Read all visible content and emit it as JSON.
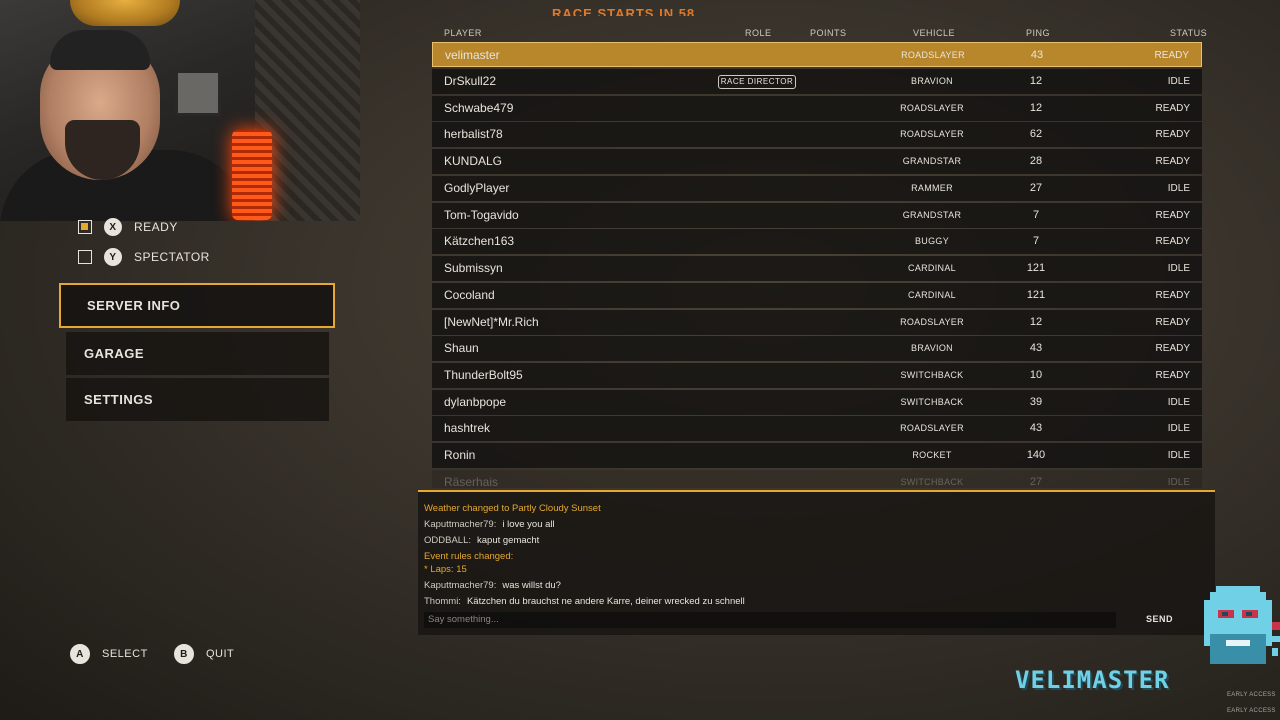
{
  "countdown": "RACE STARTS IN 58",
  "lobby": {
    "checkboxes": [
      {
        "glyph": "X",
        "label": "READY",
        "checked": true
      },
      {
        "glyph": "Y",
        "label": "SPECTATOR",
        "checked": false
      }
    ],
    "menu": [
      {
        "label": "SERVER INFO",
        "active": true
      },
      {
        "label": "GARAGE",
        "active": false
      },
      {
        "label": "SETTINGS",
        "active": false
      }
    ],
    "hints": [
      {
        "glyph": "A",
        "label": "SELECT"
      },
      {
        "glyph": "B",
        "label": "QUIT"
      }
    ]
  },
  "table": {
    "headers": {
      "player": "PLAYER",
      "role": "ROLE",
      "points": "POINTS",
      "vehicle": "VEHICLE",
      "ping": "PING",
      "status": "STATUS"
    },
    "rows": [
      {
        "player": "velimaster",
        "role": "",
        "vehicle": "ROADSLAYER",
        "ping": "43",
        "status": "READY"
      },
      {
        "player": "DrSkull22",
        "role": "RACE DIRECTOR",
        "vehicle": "BRAVION",
        "ping": "12",
        "status": "IDLE"
      },
      {
        "player": "Schwabe479",
        "role": "",
        "vehicle": "ROADSLAYER",
        "ping": "12",
        "status": "READY"
      },
      {
        "player": "herbalist78",
        "role": "",
        "vehicle": "ROADSLAYER",
        "ping": "62",
        "status": "READY"
      },
      {
        "player": "KUNDALG",
        "role": "",
        "vehicle": "GRANDSTAR",
        "ping": "28",
        "status": "READY"
      },
      {
        "player": "GodlyPlayer",
        "role": "",
        "vehicle": "RAMMER",
        "ping": "27",
        "status": "IDLE"
      },
      {
        "player": "Tom-Togavido",
        "role": "",
        "vehicle": "GRANDSTAR",
        "ping": "7",
        "status": "READY"
      },
      {
        "player": "Kätzchen163",
        "role": "",
        "vehicle": "BUGGY",
        "ping": "7",
        "status": "READY"
      },
      {
        "player": "Submissyn",
        "role": "",
        "vehicle": "CARDINAL",
        "ping": "121",
        "status": "IDLE"
      },
      {
        "player": "Cocoland",
        "role": "",
        "vehicle": "CARDINAL",
        "ping": "121",
        "status": "READY"
      },
      {
        "player": "[NewNet]*Mr.Rich",
        "role": "",
        "vehicle": "ROADSLAYER",
        "ping": "12",
        "status": "READY"
      },
      {
        "player": "Shaun",
        "role": "",
        "vehicle": "BRAVION",
        "ping": "43",
        "status": "READY"
      },
      {
        "player": "ThunderBolt95",
        "role": "",
        "vehicle": "SWITCHBACK",
        "ping": "10",
        "status": "READY"
      },
      {
        "player": "dylanbpope",
        "role": "",
        "vehicle": "SWITCHBACK",
        "ping": "39",
        "status": "IDLE"
      },
      {
        "player": "hashtrek",
        "role": "",
        "vehicle": "ROADSLAYER",
        "ping": "43",
        "status": "IDLE"
      },
      {
        "player": "Ronin",
        "role": "",
        "vehicle": "ROCKET",
        "ping": "140",
        "status": "IDLE"
      },
      {
        "player": "Räserhais",
        "role": "",
        "vehicle": "SWITCHBACK",
        "ping": "27",
        "status": "IDLE"
      }
    ]
  },
  "chat": {
    "lines": [
      {
        "type": "system",
        "text": "Weather changed to Partly Cloudy Sunset"
      },
      {
        "type": "msg",
        "name": "Kaputtmacher79:",
        "text": "i love you all"
      },
      {
        "type": "msg",
        "name": "ODDBALL:",
        "text": "kaput gemacht"
      },
      {
        "type": "system",
        "text": " Event rules changed:"
      },
      {
        "type": "system",
        "text": "* Laps: 15"
      },
      {
        "type": "msg",
        "name": "Kaputtmacher79:",
        "text": "was willst du?"
      },
      {
        "type": "msg",
        "name": "Thommi:",
        "text": "Kätzchen du brauchst ne andere Karre, deiner wrecked zu schnell"
      }
    ],
    "input_placeholder": "Say something...",
    "send_label": "SEND"
  },
  "brand": {
    "name": "VELIMASTER",
    "badge1": "EARLY ACCESS",
    "badge2": "EARLY ACCESS"
  },
  "colors": {
    "accent": "#e5a830",
    "brand": "#6fd0e6"
  }
}
